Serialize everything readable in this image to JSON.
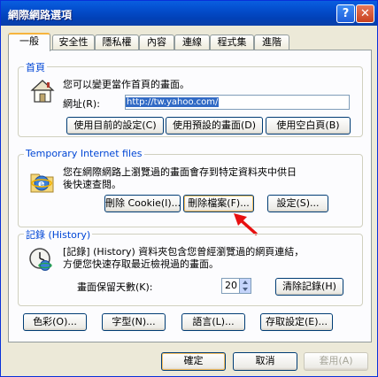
{
  "window": {
    "title": "網際網路選項",
    "help_glyph": "?",
    "close_glyph": "✕"
  },
  "tabs": [
    "一般",
    "安全性",
    "隱私權",
    "內容",
    "連線",
    "程式集",
    "進階"
  ],
  "home": {
    "group_title": "首頁",
    "description": "您可以變更當作首頁的畫面。",
    "address_label": "網址(R):",
    "address_value": "http://tw.yahoo.com/",
    "buttons": [
      "使用目前的設定(C)",
      "使用預設的畫面(D)",
      "使用空白頁(B)"
    ]
  },
  "temp": {
    "group_title": "Temporary Internet files",
    "description_line1": "您在網際網路上瀏覽過的畫面會存到特定資料夾中供日",
    "description_line2": "後快速查閱。",
    "buttons": [
      "刪除 Cookie(I)...",
      "刪除檔案(F)...",
      "設定(S)..."
    ]
  },
  "history": {
    "group_title": "記錄 (History)",
    "description_line1": "[記錄] (History) 資料夾包含您曾經瀏覽過的網頁連結，",
    "description_line2": "方便您快速存取最近檢視過的畫面。",
    "days_label": "畫面保留天數(K):",
    "days_value": "20",
    "clear_button": "清除記錄(H)"
  },
  "bottom_buttons": [
    "色彩(O)...",
    "字型(N)...",
    "語言(L)...",
    "存取設定(E)..."
  ],
  "dialog_buttons": {
    "ok": "確定",
    "cancel": "取消",
    "apply": "套用(A)"
  },
  "colors": {
    "title_bar": "#0141b8",
    "group_title": "#0046d5",
    "arrow": "#e81010"
  }
}
